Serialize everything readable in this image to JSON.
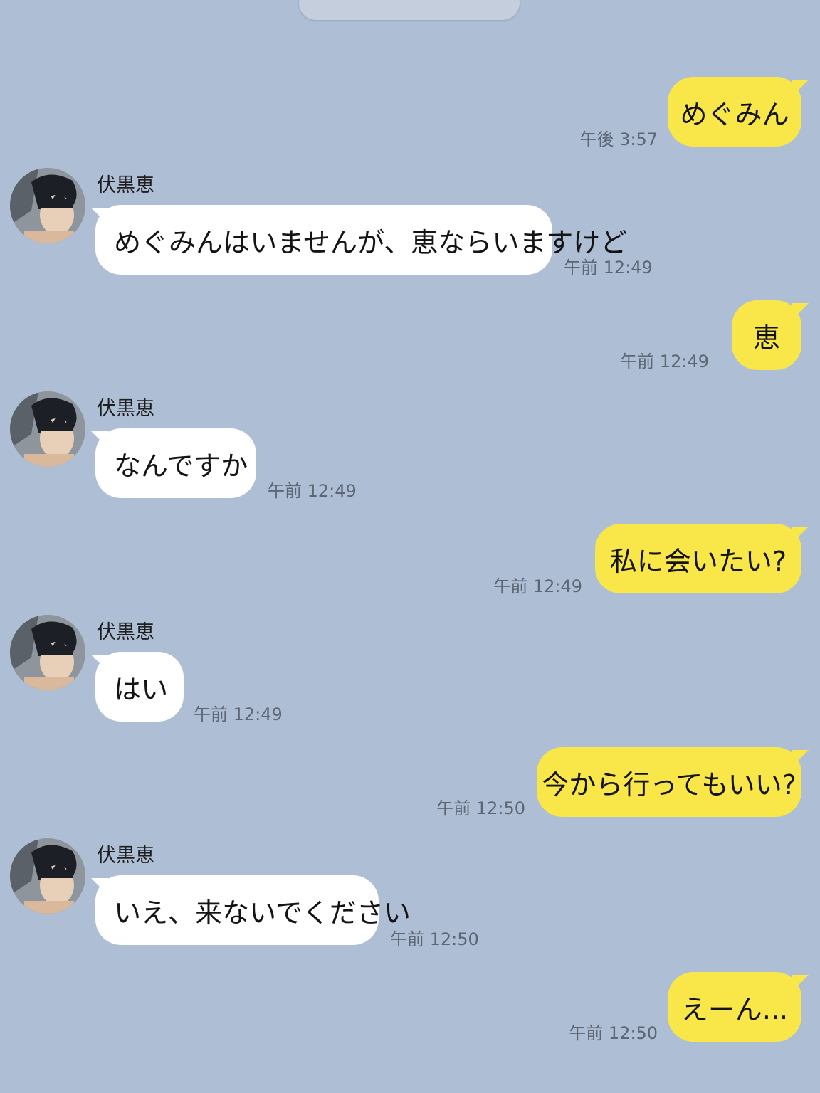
{
  "chat": {
    "contact_name": "伏黒恵",
    "messages": [
      {
        "side": "out",
        "text": "めぐみん",
        "time": "午後 3:57"
      },
      {
        "side": "in",
        "text": "めぐみんはいませんが、恵ならいますけど",
        "time": "午前 12:49"
      },
      {
        "side": "out",
        "text": "恵",
        "time": "午前 12:49"
      },
      {
        "side": "in",
        "text": "なんですか",
        "time": "午前 12:49"
      },
      {
        "side": "out",
        "text": "私に会いたい?",
        "time": "午前 12:49"
      },
      {
        "side": "in",
        "text": "はい",
        "time": "午前 12:49"
      },
      {
        "side": "out",
        "text": "今から行ってもいい?",
        "time": "午前 12:50"
      },
      {
        "side": "in",
        "text": "いえ、来ないでください",
        "time": "午前 12:50"
      },
      {
        "side": "out",
        "text": "えーん...",
        "time": "午前 12:50"
      }
    ]
  },
  "colors": {
    "background": "#aebed4",
    "outgoing_bubble": "#f9e74a",
    "incoming_bubble": "#ffffff",
    "timestamp": "#5d6675"
  },
  "icons": {
    "avatar": "contact-avatar-icon"
  }
}
